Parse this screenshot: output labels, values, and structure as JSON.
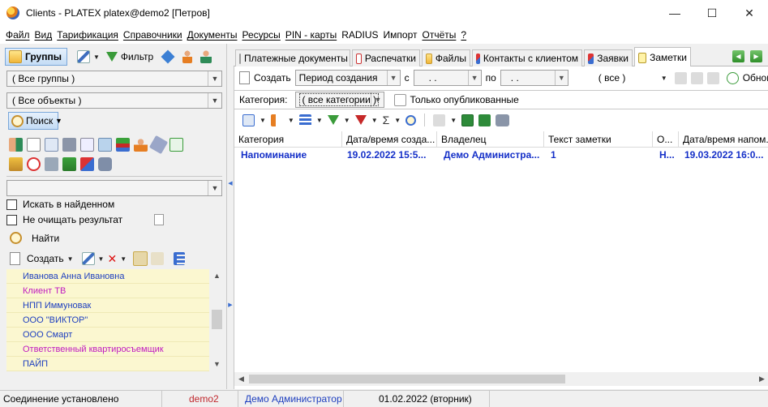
{
  "window": {
    "title": "Clients - PLATEX platex@demo2 [Петров]",
    "minimize": "—",
    "maximize": "☐",
    "close": "✕"
  },
  "menu": [
    "Файл",
    "Вид",
    "Тарификация",
    "Справочники",
    "Документы",
    "Ресурсы",
    "PIN - карты",
    "RADIUS",
    "Импорт",
    "Отчёты",
    "?"
  ],
  "left": {
    "groups_label": "Группы",
    "filter_label": "Фильтр",
    "group_combo": "( Все группы )",
    "object_combo": "( Все объекты )",
    "search_label": "Поиск",
    "search_input": "",
    "check_in_found": "Искать в найденном",
    "check_keep_results": "Не очищать результат",
    "find_label": "Найти",
    "create_label": "Создать",
    "list": [
      {
        "text": "Иванова Анна Ивановна",
        "style": "blue"
      },
      {
        "text": "Клиент ТВ",
        "style": "magenta"
      },
      {
        "text": "НПП Иммуновак",
        "style": "blue"
      },
      {
        "text": "ООО \"ВИКТОР\"",
        "style": "blue"
      },
      {
        "text": "ООО Смарт",
        "style": "blue"
      },
      {
        "text": "Ответственный квартиросъемщик",
        "style": "magenta"
      },
      {
        "text": "ПАЙП",
        "style": "blue"
      }
    ]
  },
  "tabs": [
    {
      "label": "Платежные документы",
      "active": false
    },
    {
      "label": "Распечатки",
      "active": false
    },
    {
      "label": "Файлы",
      "active": false
    },
    {
      "label": "Контакты с клиентом",
      "active": false
    },
    {
      "label": "Заявки",
      "active": false
    },
    {
      "label": "Заметки",
      "active": true
    }
  ],
  "notes": {
    "create_label": "Создать",
    "period_combo": "Период создания",
    "from_label": "с",
    "from_value": ". .",
    "to_label": "по",
    "to_value": ". .",
    "scope_combo": "( все )",
    "refresh_label": "Обнови",
    "category_label": "Категория:",
    "category_combo": "( все категории )",
    "published_only": "Только опубликованные",
    "columns": [
      "Категория",
      "Дата/время созда...",
      "Владелец",
      "Текст заметки",
      "О...",
      "Дата/время напом..."
    ],
    "rows": [
      [
        "Напоминание",
        "19.02.2022 15:5...",
        "Демо Администра...",
        "1",
        "Н...",
        "19.03.2022 16:0..."
      ]
    ]
  },
  "status": {
    "connection": "Соединение установлено",
    "db": "demo2",
    "user": "Демо Администратор",
    "date": "01.02.2022 (вторник)"
  },
  "colors": {
    "row_text": "#1530c8",
    "list_bg": "#fbf7d0",
    "status_db": "#c0282d",
    "status_user": "#1e3fbf"
  }
}
